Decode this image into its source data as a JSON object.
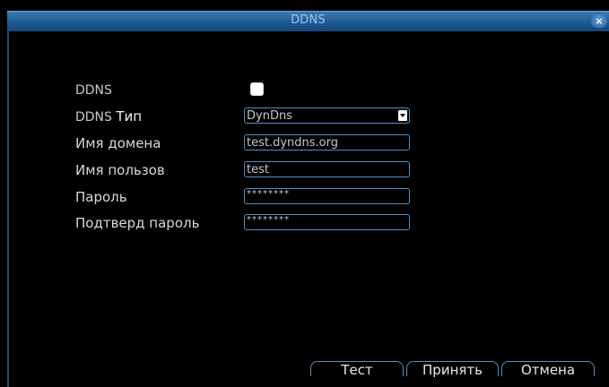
{
  "window": {
    "title": "DDNS",
    "close_glyph": "×"
  },
  "form": {
    "ddns_label": "DDNS",
    "ddns_enabled": false,
    "type_label_prefix": "DDNS",
    "type_label_suffix": "Тип",
    "type_value": "DynDns",
    "domain_label": "Имя домена",
    "domain_value": "test.dyndns.org",
    "username_label": "Имя пользов",
    "username_value": "test",
    "password_label": "Пароль",
    "password_value": "********",
    "confirm_label": "Подтверд пароль",
    "confirm_value": "********"
  },
  "buttons": {
    "test": "Тест",
    "apply": "Принять",
    "cancel": "Отмена"
  },
  "colors": {
    "titlebar": "#1f5a93",
    "field_border": "#4a8fd0",
    "background": "#000000"
  }
}
